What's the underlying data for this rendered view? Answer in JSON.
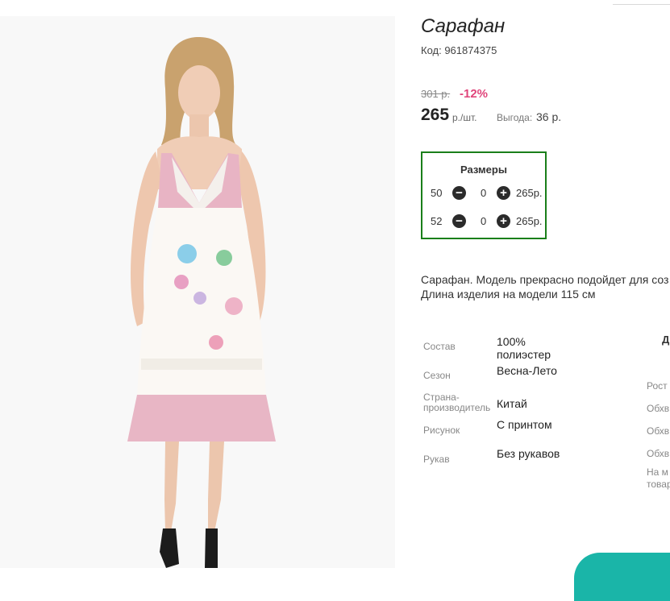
{
  "product": {
    "title": "Сарафан",
    "code_label": "Код: 961874375",
    "old_price": "301 р.",
    "discount": "-12%",
    "price": "265",
    "unit": "р./шт.",
    "saving_label": "Выгода:",
    "saving_value": "36 р."
  },
  "sizes": {
    "title": "Размеры",
    "rows": [
      {
        "size": "50",
        "minus": "−",
        "qty": "0",
        "plus": "+",
        "price": "265р."
      },
      {
        "size": "52",
        "minus": "−",
        "qty": "0",
        "plus": "+",
        "price": "265р."
      }
    ]
  },
  "description": {
    "line1": "Сарафан. Модель прекрасно подойдет для соз",
    "line2": "Длина изделия на модели 115 см"
  },
  "properties": [
    {
      "label": "Состав",
      "value": "100% полиэстер"
    },
    {
      "label": "Сезон",
      "value": "Весна-Лето"
    },
    {
      "label": "Страна-производитель",
      "value": "Китай"
    },
    {
      "label": "Рисунок",
      "value": "С принтом"
    },
    {
      "label": "Рукав",
      "value": "Без рукавов"
    }
  ],
  "measurements": {
    "heading": "Д",
    "items": [
      "Рост",
      "Обхв",
      "Обхв",
      "Обхв",
      "На м",
      "товар"
    ]
  },
  "colors": {
    "accent_pink": "#e0457b",
    "sizes_border": "#1a7f1a",
    "teal": "#1ab5a8"
  }
}
